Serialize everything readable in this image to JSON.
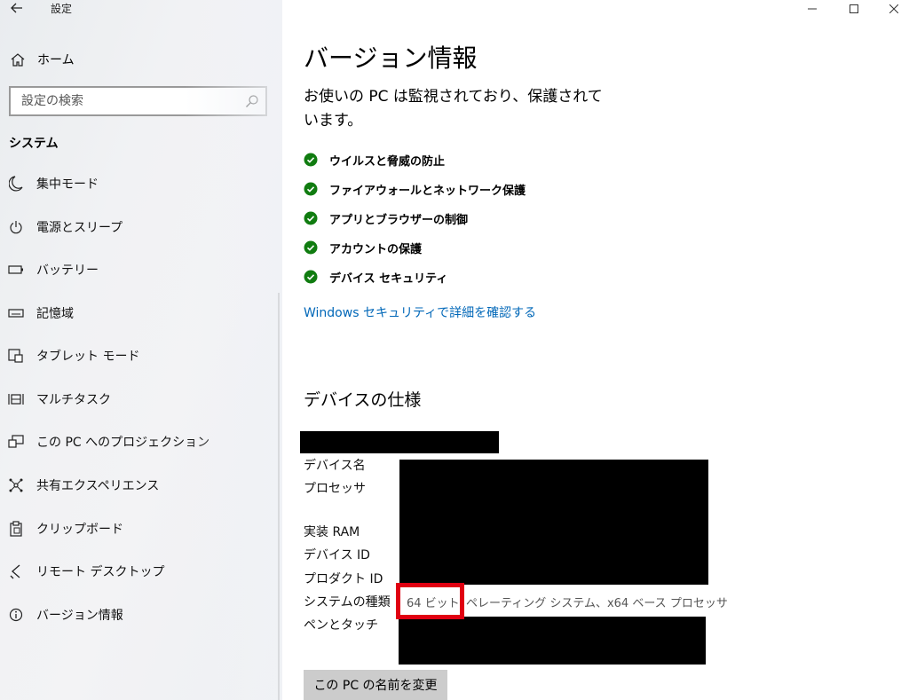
{
  "window": {
    "title": "設定",
    "controls": {
      "minimize": "—",
      "maximize": "☐",
      "close": "✕"
    }
  },
  "sidebar": {
    "home_label": "ホーム",
    "search_placeholder": "設定の検索",
    "section_title": "システム",
    "items": [
      {
        "label": "集中モード",
        "icon": "moon-icon"
      },
      {
        "label": "電源とスリープ",
        "icon": "power-icon"
      },
      {
        "label": "バッテリー",
        "icon": "battery-icon"
      },
      {
        "label": "記憶域",
        "icon": "storage-icon"
      },
      {
        "label": "タブレット モード",
        "icon": "tablet-mode-icon"
      },
      {
        "label": "マルチタスク",
        "icon": "multitask-icon"
      },
      {
        "label": "この PC へのプロジェクション",
        "icon": "projection-icon"
      },
      {
        "label": "共有エクスペリエンス",
        "icon": "shared-experience-icon"
      },
      {
        "label": "クリップボード",
        "icon": "clipboard-icon"
      },
      {
        "label": "リモート デスクトップ",
        "icon": "remote-desktop-icon"
      },
      {
        "label": "バージョン情報",
        "icon": "info-icon"
      }
    ]
  },
  "main": {
    "title": "バージョン情報",
    "status_text": "お使いの PC は監視されており、保護されています。",
    "protections": [
      "ウイルスと脅威の防止",
      "ファイアウォールとネットワーク保護",
      "アプリとブラウザーの制御",
      "アカウントの保護",
      "デバイス セキュリティ"
    ],
    "security_link": "Windows セキュリティで詳細を確認する",
    "spec_title": "デバイスの仕様",
    "spec_labels": {
      "device_name": "デバイス名",
      "processor": "プロセッサ",
      "ram": "実装 RAM",
      "device_id": "デバイス ID",
      "product_id": "プロダクト ID",
      "system_type": "システムの種類",
      "pen_touch": "ペンとタッチ"
    },
    "system_type_bits": "64 ビット",
    "system_type_rest": "ペレーティング システム、x64 ベース プロセッサ",
    "rename_button": "この PC の名前を変更"
  },
  "colors": {
    "accent_link": "#0067b8",
    "check_green": "#107c10",
    "highlight_red": "#e00012"
  }
}
